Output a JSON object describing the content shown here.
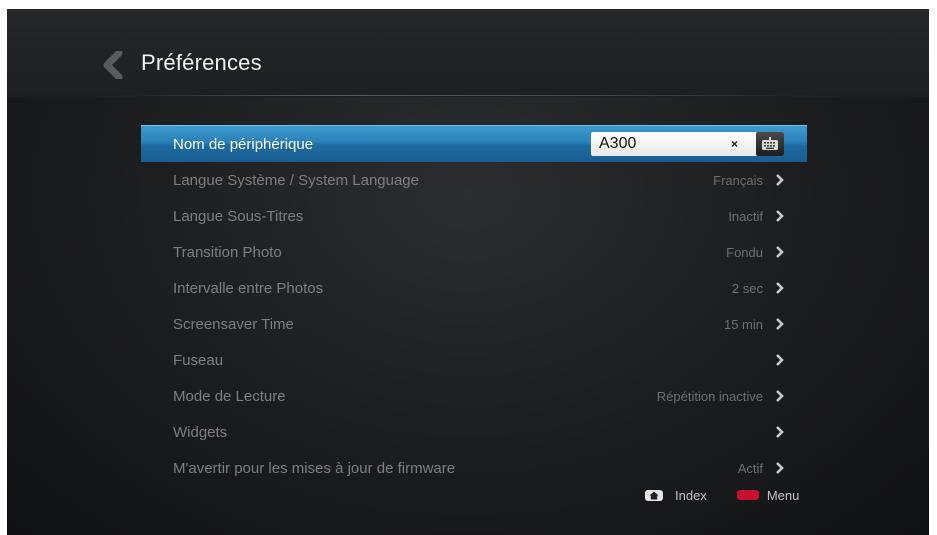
{
  "header": {
    "title": "Préférences"
  },
  "selected_row": {
    "label": "Nom de périphérique",
    "field_value": "A300",
    "clear_glyph": "×"
  },
  "rows": [
    {
      "label": "Langue Système / System Language",
      "value": "Français"
    },
    {
      "label": "Langue Sous-Titres",
      "value": "Inactif"
    },
    {
      "label": "Transition Photo",
      "value": "Fondu"
    },
    {
      "label": "Intervalle entre Photos",
      "value": "2 sec"
    },
    {
      "label": "Screensaver Time",
      "value": "15 min"
    },
    {
      "label": "Fuseau",
      "value": ""
    },
    {
      "label": "Mode de Lecture",
      "value": "Répétition inactive"
    },
    {
      "label": "Widgets",
      "value": ""
    },
    {
      "label": "M'avertir pour les mises à jour de firmware",
      "value": "Actif"
    }
  ],
  "footer": {
    "index_label": "Index",
    "menu_label": "Menu"
  },
  "colors": {
    "selection": "#2a7fb7",
    "menu_button": "#c8102e"
  },
  "icons": {
    "back": "back-arrow-icon",
    "row": "chevron-right-icon",
    "keyboard": "keyboard-icon",
    "home": "home-icon"
  }
}
